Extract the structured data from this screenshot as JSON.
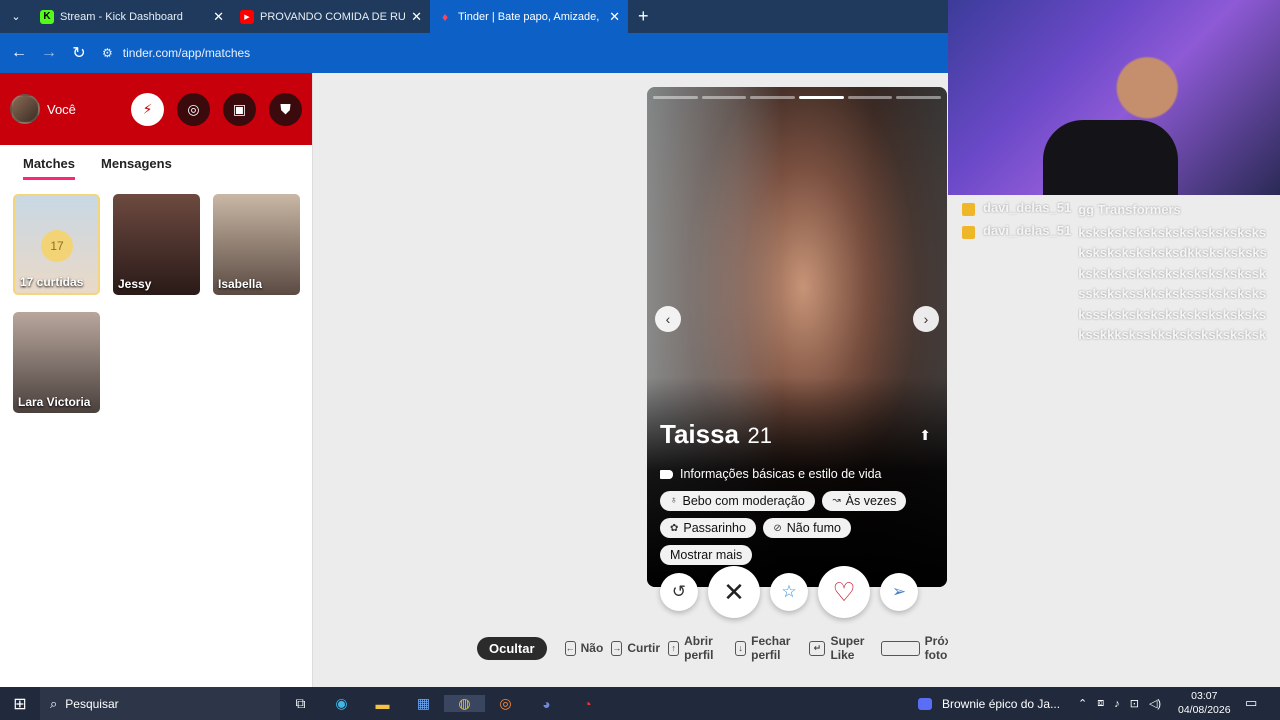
{
  "browser": {
    "tabs": [
      {
        "title": "Stream - Kick Dashboard",
        "favicon": "K",
        "active": false
      },
      {
        "title": "PROVANDO COMIDA DE RUA E",
        "favicon": "▶",
        "active": false
      },
      {
        "title": "Tinder | Bate papo, Amizade, En",
        "favicon": "♦",
        "active": true
      }
    ],
    "new_tab": "+",
    "url": "tinder.com/app/matches"
  },
  "sidebar": {
    "user_label": "Você",
    "tabs": [
      "Matches",
      "Mensagens"
    ],
    "likes": {
      "count": "17",
      "label": "17 curtidas"
    },
    "matches": [
      {
        "name": "Jessy",
        "color": "#5a3a34"
      },
      {
        "name": "Isabella",
        "color": "#8a7a6a"
      },
      {
        "name": "Lara Victoria",
        "color": "#9c8d85"
      }
    ]
  },
  "profile": {
    "name": "Taissa",
    "age": "21",
    "info_title": "Informações básicas e estilo de vida",
    "chips": [
      {
        "icon": "glass-icon",
        "label": "Bebo com moderação"
      },
      {
        "icon": "hand-icon",
        "label": "Às vezes"
      },
      {
        "icon": "bird-icon",
        "label": "Passarinho"
      },
      {
        "icon": "no-smoking-icon",
        "label": "Não fumo"
      }
    ],
    "show_more": "Mostrar mais",
    "photo_index": 4,
    "photo_count": 6
  },
  "hints": {
    "hide": "Ocultar",
    "items": [
      {
        "key": "←",
        "label": "Não"
      },
      {
        "key": "→",
        "label": "Curtir"
      },
      {
        "key": "↑",
        "label": "Abrir perfil"
      },
      {
        "key": "↓",
        "label": "Fechar perfil"
      },
      {
        "key": "↵",
        "label": "Super Like"
      },
      {
        "key": "",
        "label": "Próxima foto"
      }
    ]
  },
  "chat": [
    {
      "user": "davi_delas_51",
      "message": "gg Transformers"
    },
    {
      "user": "davi_delas_51",
      "message": "ksksksksksksksksksksksksksksksksksksksksdkksksksksksksksksksksksksksksksksksskssksksksskksksksssksksksksksssksksksksksksksksksksksksskkksksskksksksksksksksksskssksks"
    }
  ],
  "taskbar": {
    "search_placeholder": "Pesquisar",
    "media_title": "Brownie épico do Ja...",
    "time": "03:07",
    "date": "04/08/2026"
  },
  "colors": {
    "tinder_red": "#c8000b",
    "browser_blue": "#0d61c6",
    "like_pink": "#fd267a"
  }
}
